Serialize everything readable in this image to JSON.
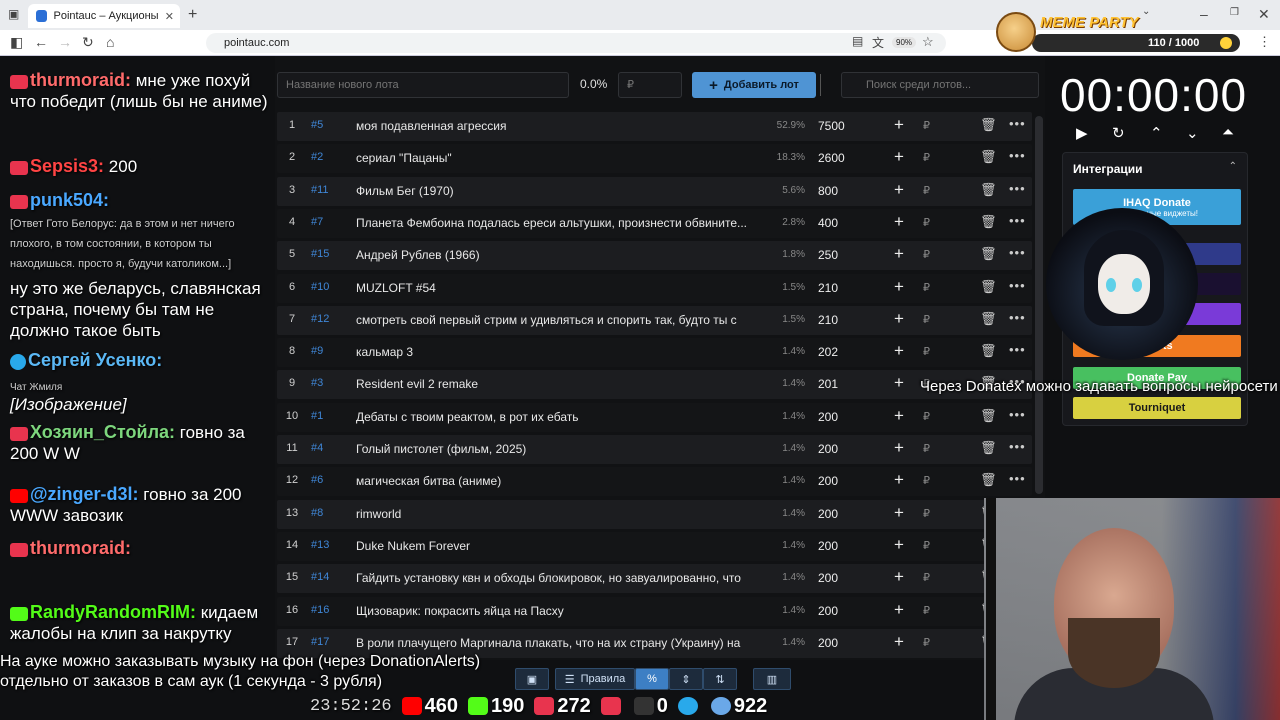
{
  "browser": {
    "tab_title": "Pointauc – Аукционы, лотереи",
    "url": "pointauc.com",
    "zoom": "90%"
  },
  "meme_party": {
    "title": "MEME PARTY",
    "progress_text": "110 / 1000",
    "progress_fraction": 0.11
  },
  "chat": [
    {
      "platform": "live",
      "nick": "thurmoraid:",
      "nick_color": "#ff6b6b",
      "text": "мне уже похуй что победит (лишь бы не аниме)"
    },
    {
      "platform": "live",
      "nick": "Sepsis3:",
      "nick_color": "#ff4444",
      "text": "200"
    },
    {
      "platform": "live",
      "nick": "punk504:",
      "nick_color": "#4aa8ff",
      "text": ""
    },
    {
      "platform": "quote",
      "text": "[Ответ Гото Белорус: да в этом и нет ничего плохого, в том состоянии, в котором ты находишься. просто я, будучи католиком...]"
    },
    {
      "platform": "none",
      "text": "ну это же беларусь, славянская страна, почему бы там не должно такое быть"
    },
    {
      "platform": "tg",
      "nick": "Сергей Усенко:",
      "nick_color": "#5bb8f5",
      "text": ""
    },
    {
      "platform": "sub",
      "text": "Чат Жмиля"
    },
    {
      "platform": "none",
      "text": "[Изображение]"
    },
    {
      "platform": "live",
      "nick": "Хозяин_Стойла:",
      "nick_color": "#7dd67d",
      "text": "говно за 200 W W"
    },
    {
      "platform": "yt",
      "nick": "@zinger-d3l:",
      "nick_color": "#4aa8ff",
      "text": "говно за 200 WWW завозик"
    },
    {
      "platform": "live",
      "nick": "thurmoraid:",
      "nick_color": "#ff6b6b",
      "text": ""
    },
    {
      "platform": "k",
      "nick": "RandyRandomRIM:",
      "nick_color": "#53fc18",
      "text": "кидаем жалобы на клип за накрутку"
    }
  ],
  "toolbar": {
    "lot_placeholder": "Название нового лота",
    "percent": "0.0%",
    "rub_placeholder": "₽",
    "add_button": "Добавить лот",
    "search_placeholder": "Поиск среди лотов..."
  },
  "lots": [
    {
      "n": "1",
      "id": "#5",
      "name": "моя подавленная агрессия",
      "pct": "52.9%",
      "amount": "7500"
    },
    {
      "n": "2",
      "id": "#2",
      "name": "сериал \"Пацаны\"",
      "pct": "18.3%",
      "amount": "2600"
    },
    {
      "n": "3",
      "id": "#11",
      "name": "Фильм Бег (1970)",
      "pct": "5.6%",
      "amount": "800"
    },
    {
      "n": "4",
      "id": "#7",
      "name": "Планета Фембоина подалась ереси альтушки, произнести обвините...",
      "pct": "2.8%",
      "amount": "400"
    },
    {
      "n": "5",
      "id": "#15",
      "name": "Андрей Рублев (1966)",
      "pct": "1.8%",
      "amount": "250"
    },
    {
      "n": "6",
      "id": "#10",
      "name": "MUZLOFT #54",
      "pct": "1.5%",
      "amount": "210"
    },
    {
      "n": "7",
      "id": "#12",
      "name": "смотреть свой первый стрим и удивляться и спорить так, будто ты с",
      "pct": "1.5%",
      "amount": "210"
    },
    {
      "n": "8",
      "id": "#9",
      "name": "кальмар 3",
      "pct": "1.4%",
      "amount": "202"
    },
    {
      "n": "9",
      "id": "#3",
      "name": "Resident evil 2 remake",
      "pct": "1.4%",
      "amount": "201"
    },
    {
      "n": "10",
      "id": "#1",
      "name": "Дебаты с твоим реактом, в рот их ебать",
      "pct": "1.4%",
      "amount": "200"
    },
    {
      "n": "11",
      "id": "#4",
      "name": "Голый пистолет (фильм, 2025)",
      "pct": "1.4%",
      "amount": "200"
    },
    {
      "n": "12",
      "id": "#6",
      "name": "магическая битва (аниме)",
      "pct": "1.4%",
      "amount": "200"
    },
    {
      "n": "13",
      "id": "#8",
      "name": "rimworld",
      "pct": "1.4%",
      "amount": "200"
    },
    {
      "n": "14",
      "id": "#13",
      "name": "Duke Nukem Forever",
      "pct": "1.4%",
      "amount": "200"
    },
    {
      "n": "15",
      "id": "#14",
      "name": "Гайдить установку квн и обходы блокировок, но завуалированно, что",
      "pct": "1.4%",
      "amount": "200"
    },
    {
      "n": "16",
      "id": "#16",
      "name": "Щизоварик: покрасить яйца на Пасху",
      "pct": "1.4%",
      "amount": "200"
    },
    {
      "n": "17",
      "id": "#17",
      "name": "В роли плачущего Маргинала плакать, что на их страну (Украину) на",
      "pct": "1.4%",
      "amount": "200"
    }
  ],
  "currency_symbol": "₽",
  "bottombar": {
    "rules": "Правила",
    "percent": "%"
  },
  "timer": {
    "value": "00:00:00"
  },
  "integrations": {
    "header": "Интеграции",
    "items": [
      {
        "label": "IHAQ Donate",
        "color": "#3aa0d8"
      },
      {
        "label": "er",
        "color": "#2f3a8a"
      },
      {
        "label": "",
        "color": "#1a1030"
      },
      {
        "label": "",
        "color": "#7a3ad8"
      },
      {
        "label": "Alerts",
        "color": "#f07a20"
      },
      {
        "label": "Donate Pay",
        "color": "#48c060"
      },
      {
        "label": "Tourniquet",
        "color": "#d8d040"
      }
    ],
    "ihaq_sub": "Уникальные виджеты!"
  },
  "overlay": {
    "donatex": "Через Donatex можно задавать вопросы нейросети",
    "music_line1": "На ауке можно заказывать музыку на фон (через DonationAlerts)",
    "music_line2": "отдельно от заказов в сам аук (1 секунда - 3 рубля)"
  },
  "stats": {
    "clock": "23:52:26",
    "youtube": "460",
    "kick": "190",
    "live": "272",
    "r": "0",
    "telegram": "",
    "viewers": "922"
  }
}
